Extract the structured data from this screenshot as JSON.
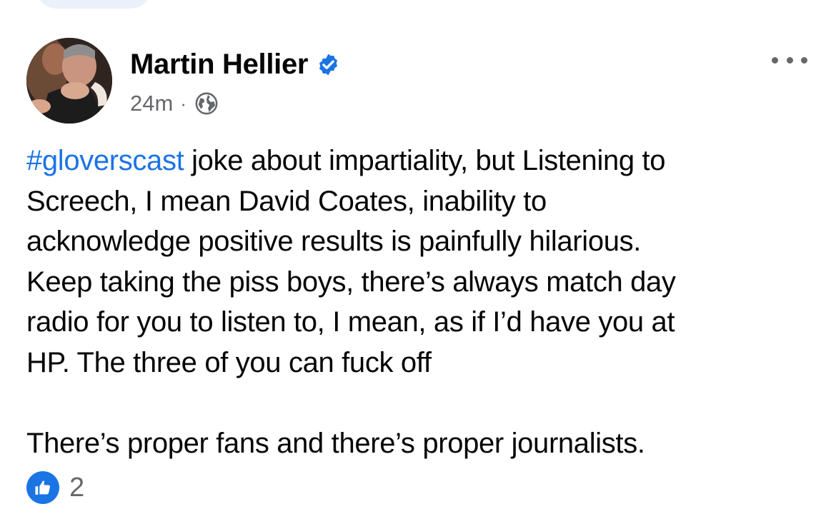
{
  "post": {
    "author": {
      "name": "Martin Hellier",
      "verified": true,
      "avatar_icon": "profile-photo"
    },
    "meta": {
      "time": "24m",
      "separator": "·",
      "audience_icon": "globe-icon"
    },
    "more_icon": "more-horizontal-icon",
    "body": {
      "hashtag": "#gloverscast",
      "line1_rest": " joke about impartiality, but Listening to",
      "line2": "Screech, I mean David Coates, inability to",
      "line3": "acknowledge positive results is painfully hilarious.",
      "line4": "Keep taking the piss boys, there’s always match day",
      "line5": "radio for you to listen to, I mean, as if I’d have you at",
      "line6": "HP.  The three of you can fuck off",
      "line7": "There’s proper fans and there’s proper journalists."
    },
    "reactions": {
      "icon": "like-icon",
      "count": "2"
    }
  },
  "colors": {
    "link_blue": "#1b74e4",
    "secondary_text": "#65676b",
    "primary_text": "#050505"
  }
}
